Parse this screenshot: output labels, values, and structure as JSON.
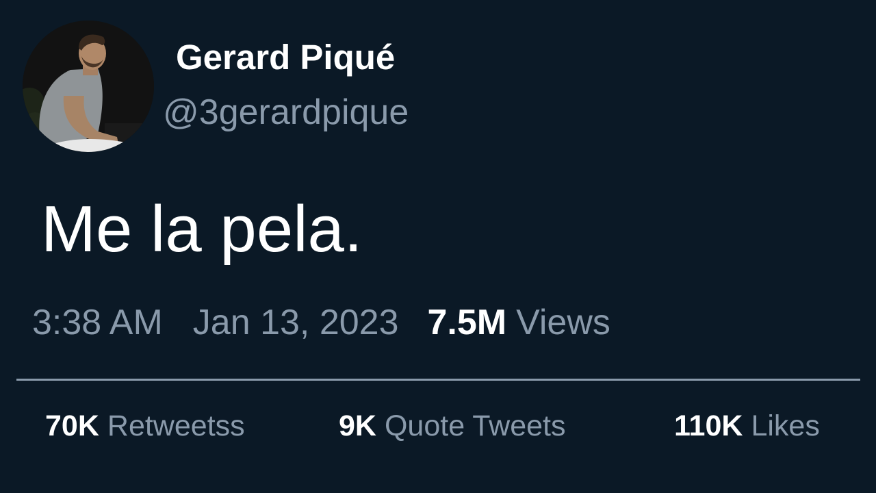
{
  "user": {
    "display_name": "Gerard Piqué",
    "handle": "@3gerardpique"
  },
  "tweet": {
    "text": "Me la pela.",
    "time": "3:38 AM",
    "date": "Jan 13, 2023",
    "views_count": "7.5M",
    "views_label": "Views"
  },
  "stats": {
    "retweets_count": "70K",
    "retweets_label": "Retweetss",
    "quotes_count": "9K",
    "quotes_label": "Quote Tweets",
    "likes_count": "110K",
    "likes_label": "Likes"
  },
  "colors": {
    "background": "#0b1926",
    "primary_text": "#ffffff",
    "secondary_text": "#8a9aab"
  }
}
